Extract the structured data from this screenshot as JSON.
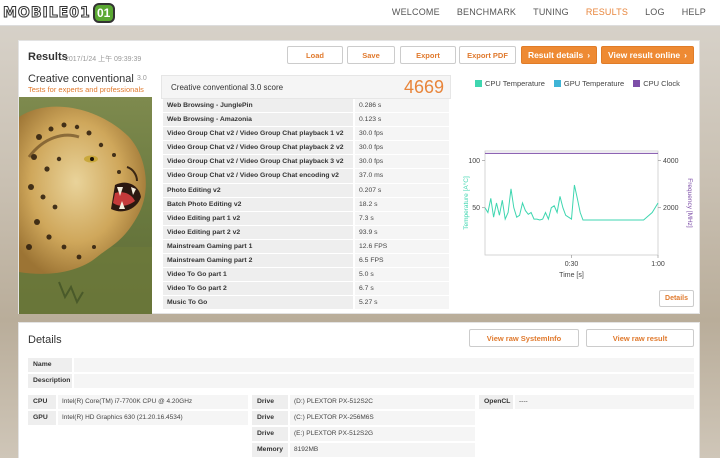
{
  "logo": {
    "text": "MOBILE01",
    "badge": "01"
  },
  "nav": [
    "WELCOME",
    "BENCHMARK",
    "TUNING",
    "RESULTS",
    "LOG",
    "HELP"
  ],
  "results": {
    "title": "Results",
    "date": "2017/1/24 上午 09:39:39",
    "buttons": {
      "load": "Load",
      "save": "Save",
      "export": "Export",
      "export_pdf": "Export PDF",
      "result_details": "Result details",
      "view_online": "View result online"
    },
    "test_name": "Creative conventional",
    "test_version": "3.0",
    "test_subtitle": "Tests for experts and professionals",
    "score_label": "Creative conventional 3.0 score",
    "score_value": "4669",
    "subtests": [
      {
        "name": "Web Browsing - JunglePin",
        "value": "0.286 s"
      },
      {
        "name": "Web Browsing - Amazonia",
        "value": "0.123 s"
      },
      {
        "name": "Video Group Chat v2 / Video Group Chat playback 1 v2",
        "value": "30.0 fps"
      },
      {
        "name": "Video Group Chat v2 / Video Group Chat playback 2 v2",
        "value": "30.0 fps"
      },
      {
        "name": "Video Group Chat v2 / Video Group Chat playback 3 v2",
        "value": "30.0 fps"
      },
      {
        "name": "Video Group Chat v2 / Video Group Chat encoding v2",
        "value": "37.0 ms"
      },
      {
        "name": "Photo Editing v2",
        "value": "0.207 s"
      },
      {
        "name": "Batch Photo Editing v2",
        "value": "18.2 s"
      },
      {
        "name": "Video Editing part 1 v2",
        "value": "7.3 s"
      },
      {
        "name": "Video Editing part 2 v2",
        "value": "93.9 s"
      },
      {
        "name": "Mainstream Gaming part 1",
        "value": "12.6 FPS"
      },
      {
        "name": "Mainstream Gaming part 2",
        "value": "6.5 FPS"
      },
      {
        "name": "Video To Go part 1",
        "value": "5.0 s"
      },
      {
        "name": "Video To Go part 2",
        "value": "6.7 s"
      },
      {
        "name": "Music To Go",
        "value": "5.27 s"
      }
    ],
    "details_button": "Details"
  },
  "chart_data": {
    "type": "line",
    "legend_position": "top",
    "xlabel": "Time [s]",
    "ylabel_left": "Temperature [A°C]",
    "ylabel_right": "Frequency [MHz]",
    "xlim": [
      0,
      60
    ],
    "ylim_left": [
      0,
      110
    ],
    "ylim_right": [
      0,
      4400
    ],
    "x_ticks": [
      "0:30",
      "1:00"
    ],
    "y_ticks_left": [
      "50",
      "100"
    ],
    "y_ticks_right": [
      "2000",
      "4000"
    ],
    "series": [
      {
        "name": "CPU Temperature",
        "color": "#3fd6b0",
        "axis": "left",
        "x": [
          0,
          1,
          2,
          3,
          4,
          5,
          6,
          7,
          8,
          9,
          10,
          11,
          12,
          13,
          14,
          15,
          16,
          17,
          18,
          19,
          20,
          21,
          22,
          23,
          24,
          25,
          26,
          27,
          28,
          29,
          30,
          31,
          32,
          33,
          34,
          35,
          36,
          37,
          38,
          39,
          40,
          45,
          50,
          55,
          58,
          60
        ],
        "y": [
          50,
          45,
          60,
          40,
          55,
          42,
          58,
          38,
          45,
          70,
          50,
          40,
          42,
          55,
          47,
          43,
          45,
          38,
          38,
          37,
          38,
          45,
          38,
          50,
          52,
          45,
          62,
          50,
          42,
          40,
          38,
          74,
          60,
          45,
          37,
          37,
          37,
          37,
          37,
          37,
          37,
          37,
          37,
          37,
          45,
          55
        ]
      },
      {
        "name": "GPU Temperature",
        "color": "#3fb4d6",
        "axis": "left",
        "x": [],
        "y": []
      },
      {
        "name": "CPU Clock",
        "color": "#7d4ea8",
        "axis": "right",
        "x": [
          0,
          60
        ],
        "y": [
          4300,
          4300
        ]
      }
    ]
  },
  "details": {
    "title": "Details",
    "buttons": {
      "raw_systeminfo": "View raw SystemInfo",
      "raw_result": "View raw result"
    },
    "name_label": "Name",
    "description_label": "Description",
    "cpu_label": "CPU",
    "cpu_value": "Intel(R) Core(TM) i7-7700K CPU @ 4.20GHz",
    "gpu_label": "GPU",
    "gpu_value": "Intel(R) HD Graphics 630 (21.20.16.4534)",
    "drives": [
      {
        "label": "Drive",
        "value": "(D:) PLEXTOR PX-512S2C"
      },
      {
        "label": "Drive",
        "value": "(C:) PLEXTOR PX-256M6S"
      },
      {
        "label": "Drive",
        "value": "(E:) PLEXTOR PX-512S2G"
      }
    ],
    "memory_label": "Memory",
    "memory_value": "8192MB",
    "opencl_label": "OpenCL",
    "opencl_value": "----"
  }
}
